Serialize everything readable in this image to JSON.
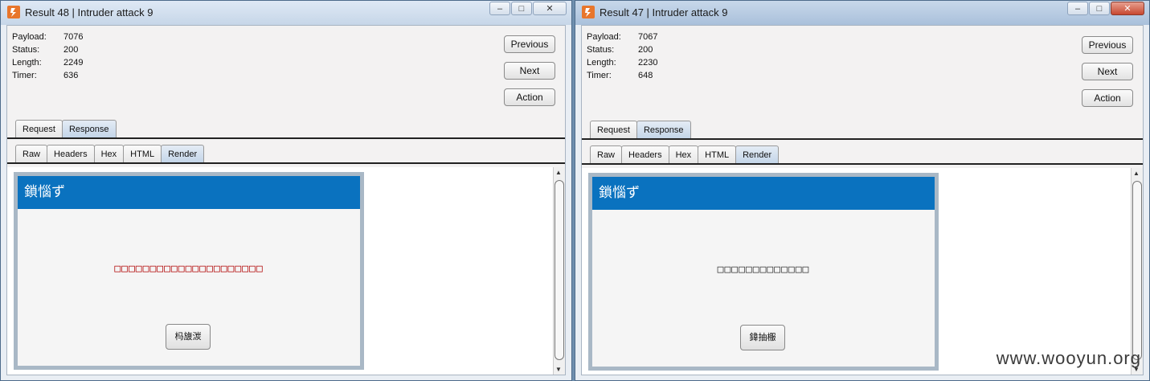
{
  "left": {
    "title": "Result 48 | Intruder attack 9",
    "info": [
      {
        "label": "Payload:",
        "value": "7076"
      },
      {
        "label": "Status:",
        "value": "200"
      },
      {
        "label": "Length:",
        "value": "2249"
      },
      {
        "label": "Timer:",
        "value": "636"
      }
    ],
    "buttons": {
      "previous": "Previous",
      "next": "Next",
      "action": "Action"
    },
    "main_tabs": [
      "Request",
      "Response"
    ],
    "sub_tabs": [
      "Raw",
      "Headers",
      "Hex",
      "HTML",
      "Render"
    ],
    "page": {
      "header": "鎖惱ず",
      "message": "□□□□□□□□□□□□□□□□□□□□□",
      "message_color": "#b00000",
      "button": "杩旇湠"
    }
  },
  "right": {
    "title": "Result 47 | Intruder attack 9",
    "info": [
      {
        "label": "Payload:",
        "value": "7067"
      },
      {
        "label": "Status:",
        "value": "200"
      },
      {
        "label": "Length:",
        "value": "2230"
      },
      {
        "label": "Timer:",
        "value": "648"
      }
    ],
    "buttons": {
      "previous": "Previous",
      "next": "Next",
      "action": "Action"
    },
    "main_tabs": [
      "Request",
      "Response"
    ],
    "sub_tabs": [
      "Raw",
      "Headers",
      "Hex",
      "HTML",
      "Render"
    ],
    "page": {
      "header": "鎖惱ず",
      "message": "□□□□□□□□□□□□□",
      "message_color": "#333333",
      "button": "鍏抽棴"
    }
  },
  "window_controls": {
    "minimize_icon": "minimize-icon",
    "maximize_icon": "maximize-icon",
    "close_icon": "close-icon"
  },
  "accent_colors": {
    "page_header": "#0a72bf",
    "active_tab": "#c2d4e8"
  },
  "watermark": "www.wooyun.org"
}
